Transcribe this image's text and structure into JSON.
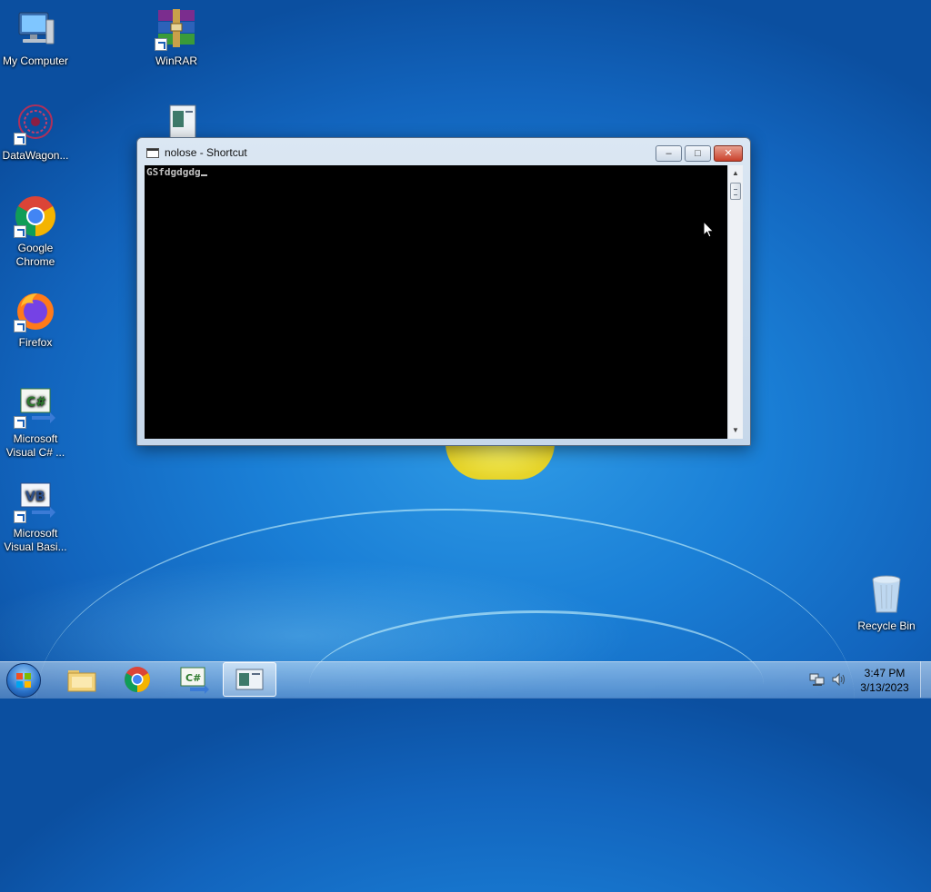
{
  "desktop": {
    "icons": [
      {
        "label": "My Computer"
      },
      {
        "label": "WinRAR"
      },
      {
        "label": "DataWagon..."
      },
      {
        "label": "Google Chrome"
      },
      {
        "label": "Firefox"
      },
      {
        "label": "Microsoft Visual C# ..."
      },
      {
        "label": "Microsoft Visual Basi..."
      },
      {
        "label": "Recycle Bin"
      }
    ]
  },
  "window": {
    "title": "nolose - Shortcut",
    "console_text": "GSfdgdgdg",
    "minimize_glyph": "–",
    "maximize_glyph": "□",
    "close_glyph": "✕"
  },
  "taskbar": {
    "clock_time": "3:47 PM",
    "clock_date": "3/13/2023"
  },
  "colors": {
    "desktop_bg": "#1a7fd6",
    "console_bg": "#000000",
    "console_text": "#c0c0c0",
    "close_button": "#c9412b"
  }
}
